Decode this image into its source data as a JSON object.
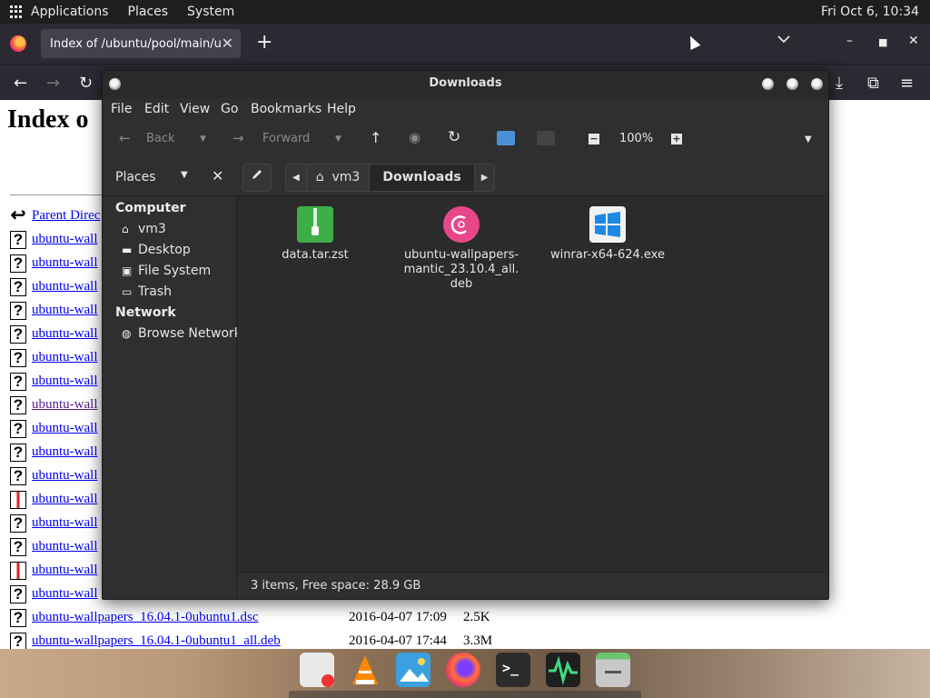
{
  "top_panel": {
    "menus": [
      "Applications",
      "Places",
      "System"
    ],
    "clock": "Fri Oct  6, 10:34"
  },
  "browser": {
    "tab_title": "Index of /ubuntu/pool/main/u/ubuntu-wallpapers",
    "page_heading": "Index o",
    "listing": [
      {
        "icon": "back-icon",
        "name": "Parent Direc",
        "date": "",
        "size": "",
        "visited": false
      },
      {
        "icon": "unknown-file-icon",
        "name": "ubuntu-wall",
        "date": "",
        "size": "",
        "visited": false
      },
      {
        "icon": "unknown-file-icon",
        "name": "ubuntu-wall",
        "date": "",
        "size": "",
        "visited": false
      },
      {
        "icon": "unknown-file-icon",
        "name": "ubuntu-wall",
        "date": "",
        "size": "",
        "visited": false
      },
      {
        "icon": "unknown-file-icon",
        "name": "ubuntu-wall",
        "date": "",
        "size": "",
        "visited": false
      },
      {
        "icon": "unknown-file-icon",
        "name": "ubuntu-wall",
        "date": "",
        "size": "",
        "visited": false
      },
      {
        "icon": "unknown-file-icon",
        "name": "ubuntu-wall",
        "date": "",
        "size": "",
        "visited": false
      },
      {
        "icon": "unknown-file-icon",
        "name": "ubuntu-wall",
        "date": "",
        "size": "",
        "visited": false
      },
      {
        "icon": "unknown-file-icon",
        "name": "ubuntu-wall",
        "date": "",
        "size": "",
        "visited": true
      },
      {
        "icon": "unknown-file-icon",
        "name": "ubuntu-wall",
        "date": "",
        "size": "",
        "visited": false
      },
      {
        "icon": "unknown-file-icon",
        "name": "ubuntu-wall",
        "date": "",
        "size": "",
        "visited": false
      },
      {
        "icon": "unknown-file-icon",
        "name": "ubuntu-wall",
        "date": "",
        "size": "",
        "visited": false
      },
      {
        "icon": "package-file-icon",
        "name": "ubuntu-wall",
        "date": "",
        "size": "",
        "visited": false
      },
      {
        "icon": "unknown-file-icon",
        "name": "ubuntu-wall",
        "date": "",
        "size": "",
        "visited": false
      },
      {
        "icon": "unknown-file-icon",
        "name": "ubuntu-wall",
        "date": "",
        "size": "",
        "visited": false
      },
      {
        "icon": "package-file-icon",
        "name": "ubuntu-wall",
        "date": "",
        "size": "",
        "visited": false
      },
      {
        "icon": "unknown-file-icon",
        "name": "ubuntu-wall",
        "date": "",
        "size": "",
        "visited": false
      },
      {
        "icon": "unknown-file-icon",
        "name": "ubuntu-wallpapers_16.04.1-0ubuntu1.dsc",
        "date": "2016-04-07 17:09",
        "size": "2.5K",
        "visited": false
      },
      {
        "icon": "unknown-file-icon",
        "name": "ubuntu-wallpapers_16.04.1-0ubuntu1_all.deb",
        "date": "2016-04-07 17:44",
        "size": "3.3M",
        "visited": false
      }
    ]
  },
  "file_manager": {
    "title": "Downloads",
    "menus": [
      "File",
      "Edit",
      "View",
      "Go",
      "Bookmarks",
      "Help"
    ],
    "toolbar": {
      "back": "Back",
      "forward": "Forward",
      "zoom": "100%"
    },
    "sidebar_mode": "Places",
    "path": [
      "vm3",
      "Downloads"
    ],
    "sidebar": {
      "computer_header": "Computer",
      "computer_items": [
        {
          "label": "vm3",
          "icon": "home-icon"
        },
        {
          "label": "Desktop",
          "icon": "desktop-icon"
        },
        {
          "label": "File System",
          "icon": "drive-icon"
        },
        {
          "label": "Trash",
          "icon": "trash-icon"
        }
      ],
      "network_header": "Network",
      "network_items": [
        {
          "label": "Browse Network",
          "icon": "network-icon"
        }
      ]
    },
    "files": [
      {
        "name": "data.tar.zst",
        "icon": "archive-icon",
        "color": "#3fae49"
      },
      {
        "name": "ubuntu-wallpapers-\nmantic_23.10.4_all.\ndeb",
        "icon": "debian-package-icon",
        "color": "#e8488a"
      },
      {
        "name": "winrar-x64-624.exe",
        "icon": "windows-exe-icon",
        "color": "#1e88e5"
      }
    ],
    "status": "3 items, Free space: 28.9 GB"
  }
}
